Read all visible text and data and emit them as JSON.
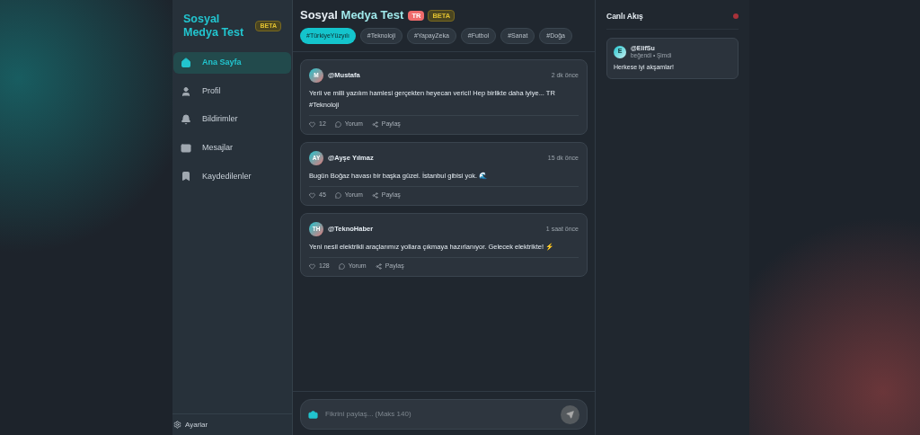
{
  "sidebar": {
    "brand": "Sosyal Medya Test",
    "brand_badge": "BETA",
    "items": [
      {
        "label": "Ana Sayfa",
        "selected": true
      },
      {
        "label": "Profil",
        "selected": false
      },
      {
        "label": "Bildirimler",
        "selected": false
      },
      {
        "label": "Mesajlar",
        "selected": false
      },
      {
        "label": "Kaydedilenler",
        "selected": false
      }
    ],
    "settings": "Ayarlar"
  },
  "header": {
    "title_start": "Sosyal",
    "title_end": "Medya Test",
    "badges": [
      {
        "label": "TR",
        "kind": "flag"
      },
      {
        "label": "BETA",
        "kind": "beta"
      }
    ],
    "tags": [
      {
        "label": "#TürkiyeYüzyılı",
        "selected": true
      },
      {
        "label": "#Teknoloji",
        "selected": false
      },
      {
        "label": "#YapayZeka",
        "selected": false
      },
      {
        "label": "#Futbol",
        "selected": false
      },
      {
        "label": "#Sanat",
        "selected": false
      },
      {
        "label": "#Doğa",
        "selected": false
      }
    ]
  },
  "posts": [
    {
      "initials": "M",
      "user": "@Mustafa",
      "time": "2 dk önce",
      "text": "Yerli ve milli yazılım hamlesi gerçekten heyecan verici! Hep birlikte daha iyiye... TR #Teknoloji",
      "likes": "12",
      "comment": "Yorum",
      "share": "Paylaş"
    },
    {
      "initials": "AY",
      "user": "@Ayşe Yılmaz",
      "time": "15 dk önce",
      "text": "Bugün Boğaz havası bir başka güzel. İstanbul gibisi yok. 🌊",
      "likes": "45",
      "comment": "Yorum",
      "share": "Paylaş"
    },
    {
      "initials": "TH",
      "user": "@TeknoHaber",
      "time": "1 saat önce",
      "text": "Yeni nesil elektrikli araçlarımız yollara çıkmaya hazırlanıyor. Gelecek elektrikte! ⚡",
      "likes": "128",
      "comment": "Yorum",
      "share": "Paylaş"
    }
  ],
  "composer": {
    "placeholder": "Fikrini paylaş... (Maks 140)"
  },
  "live": {
    "title": "Canlı Akış",
    "on": true,
    "events": [
      {
        "initial": "E",
        "user": "@ElifSu",
        "meta": "beğendi • Şimdi",
        "text": "Herkese iyi akşamlar!"
      }
    ]
  }
}
